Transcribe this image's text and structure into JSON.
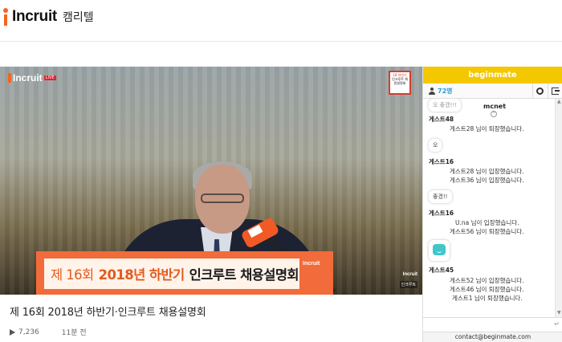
{
  "header": {
    "logo_text": "Incruit",
    "logo_sub": "캠리텔"
  },
  "video": {
    "logo_text": "Incruit",
    "live_label": "LIVE",
    "badge_line1": "18 하반기",
    "badge_line2": "인크루트 채용설명회",
    "banner_part1": "제 16회",
    "banner_part2": "2018년 하반기",
    "banner_part3": "인크루트 채용설명회",
    "banner_logo": "Incruit",
    "watermark": "Incruit",
    "watermark2": "인크루트"
  },
  "video_info": {
    "title": "제 16회 2018년 하반기·인크루트 채용설명회",
    "views": "7,236",
    "time_ago": "11분 전"
  },
  "chat": {
    "header_title": "beginmate",
    "user_count": "72명",
    "mcnet_label": "mcnet",
    "messages": {
      "bubble1": "오 좋겠!!!",
      "name1": "게스트48",
      "sys1": "게스트28 님이 퇴장했습니다.",
      "bubble2": "오",
      "name2": "게스트16",
      "sys2": "게스트28 님이 입장했습니다.",
      "sys3": "게스트36 님이 입장했습니다.",
      "bubble3": "좋겠!!",
      "name3": "게스트16",
      "sys4": "U.na 님이 입장했습니다.",
      "sys5": "게스트56 님이 퇴장했습니다.",
      "name4": "게스트45",
      "sys6": "게스트52 님이 입장했습니다.",
      "sys7": "게스트46 님이 퇴장했습니다.",
      "sys8": "게스트1 님이 퇴장했습니다."
    },
    "footer_contact": "contact@beginmate.com"
  }
}
